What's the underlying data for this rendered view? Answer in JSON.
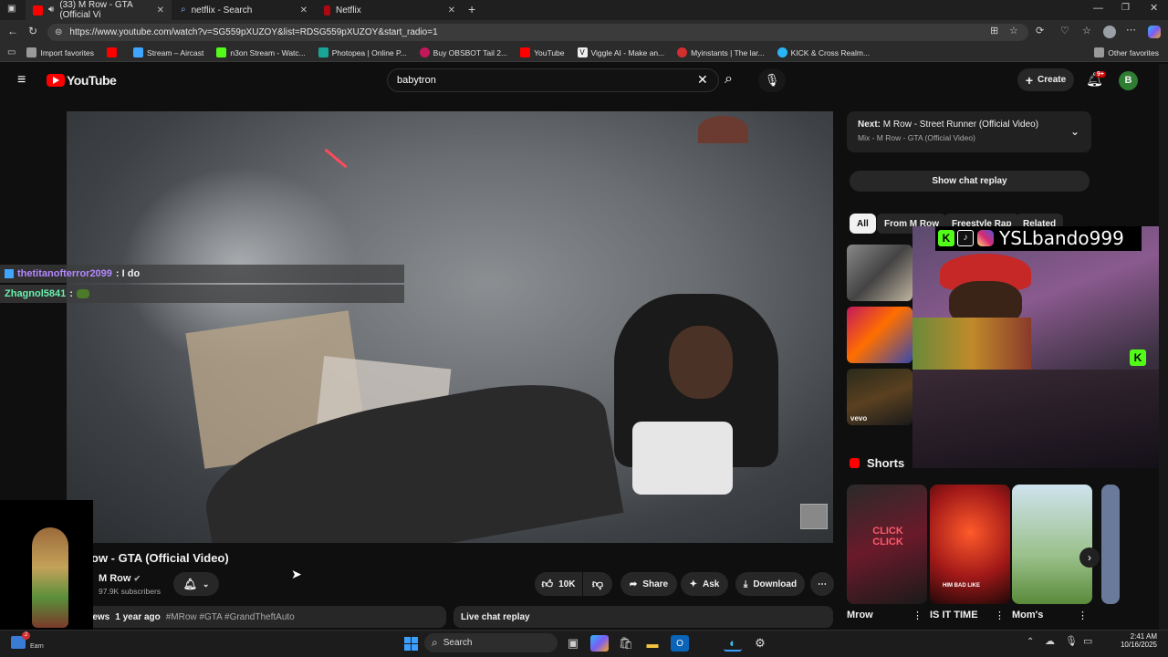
{
  "browser": {
    "tabs": [
      {
        "label": "(33) M Row - GTA (Official Vi",
        "close": "✕"
      },
      {
        "label": "netflix - Search",
        "close": "✕"
      },
      {
        "label": "Netflix",
        "close": "✕"
      }
    ],
    "new_tab": "+",
    "url": "https://www.youtube.com/watch?v=SG559pXUZOY&list=RDSG559pXUZOY&start_radio=1",
    "bookmarks": [
      "Import favorites",
      "",
      "Stream – Aircast",
      "n3on Stream - Watc...",
      "Photopea | Online P...",
      "Buy OBSBOT Tail 2...",
      "YouTube",
      "Viggle AI - Make an...",
      "Myinstants | The lar...",
      "KICK & Cross Realm..."
    ],
    "other_favorites": "Other favorites"
  },
  "youtube": {
    "logo_text": "YouTube",
    "search_value": "babytron",
    "create_label": "Create",
    "notif_count": "9+",
    "avatar_letter": "B"
  },
  "chat_overlay": [
    {
      "user": "thetitanofterror2099",
      "msg": ": I do",
      "color": "#b388ff"
    },
    {
      "user": "Zhagnol5841",
      "msg": ":",
      "color": "#69f0ae"
    }
  ],
  "video": {
    "title": "ow - GTA (Official Video)",
    "channel": "M Row",
    "subscribers": "97.9K subscribers",
    "likes": "10K",
    "share": "Share",
    "ask": "Ask",
    "download": "Download",
    "views": "views",
    "age": "1 year ago",
    "hashtags": "#MRow #GTA #GrandTheftAuto",
    "live_chat_replay": "Live chat replay"
  },
  "sidebar": {
    "next_prefix": "Next:",
    "next_title": "M Row - Street Runner (Official Video)",
    "next_sub": "Mix - M Row - GTA (Official Video)",
    "show_chat_replay": "Show chat replay",
    "chips": [
      "All",
      "From M Row",
      "Freestyle Rap",
      "Related"
    ],
    "shorts_heading": "Shorts",
    "shorts": [
      {
        "title": "Mrow",
        "overlay": "CLICK CLICK"
      },
      {
        "title": "IS IT TIME",
        "overlay": "HIM BAD LIKE"
      },
      {
        "title": "Mom's",
        "overlay": ""
      }
    ],
    "vevo": "vevo"
  },
  "stream_overlay": {
    "handle": "YSLbando999"
  },
  "taskbar": {
    "search_label": "Search",
    "time": "2:41 AM",
    "date": "10/16/2025",
    "weather_badge": "2",
    "weather_label": "Earn"
  },
  "colors": {
    "youtube_red": "#ff0000",
    "kick_green": "#53fc18",
    "accent_blue": "#3ea6ff"
  }
}
